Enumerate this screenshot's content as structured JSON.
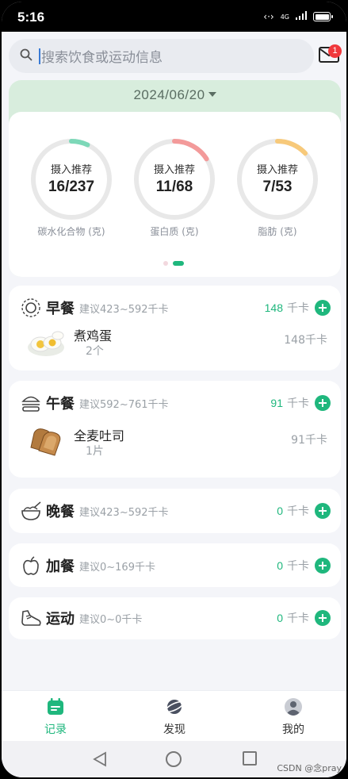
{
  "status": {
    "time": "5:16",
    "signal": "4G"
  },
  "search": {
    "placeholder": "搜索饮食或运动信息",
    "mail_badge": "1"
  },
  "date": {
    "label": "2024/06/20"
  },
  "macros": [
    {
      "top_label": "摄入推荐",
      "value": "16/237",
      "caption": "碳水化合物 (克)",
      "color": "#7dd8b8",
      "progress": 0.07
    },
    {
      "top_label": "摄入推荐",
      "value": "11/68",
      "caption": "蛋白质 (克)",
      "color": "#f39a9a",
      "progress": 0.16
    },
    {
      "top_label": "摄入推荐",
      "value": "7/53",
      "caption": "脂肪 (克)",
      "color": "#f7c97a",
      "progress": 0.13
    }
  ],
  "meals": {
    "breakfast": {
      "name": "早餐",
      "suggest": "建议423~592千卡",
      "kcal": "148",
      "unit": "千卡",
      "foods": [
        {
          "name": "煮鸡蛋",
          "qty": "2个",
          "kcal": "148千卡"
        }
      ]
    },
    "lunch": {
      "name": "午餐",
      "suggest": "建议592~761千卡",
      "kcal": "91",
      "unit": "千卡",
      "foods": [
        {
          "name": "全麦吐司",
          "qty": "1片",
          "kcal": "91千卡"
        }
      ]
    },
    "dinner": {
      "name": "晚餐",
      "suggest": "建议423~592千卡",
      "kcal": "0",
      "unit": "千卡"
    },
    "snack": {
      "name": "加餐",
      "suggest": "建议0~169千卡",
      "kcal": "0",
      "unit": "千卡"
    },
    "exercise": {
      "name": "运动",
      "suggest": "建议0~0千卡",
      "kcal": "0",
      "unit": "千卡"
    }
  },
  "tabs": [
    {
      "label": "记录",
      "icon": "calendar-icon",
      "active": true
    },
    {
      "label": "发现",
      "icon": "planet-icon",
      "active": false
    },
    {
      "label": "我的",
      "icon": "user-icon",
      "active": false
    }
  ],
  "watermark": "CSDN @念pray"
}
